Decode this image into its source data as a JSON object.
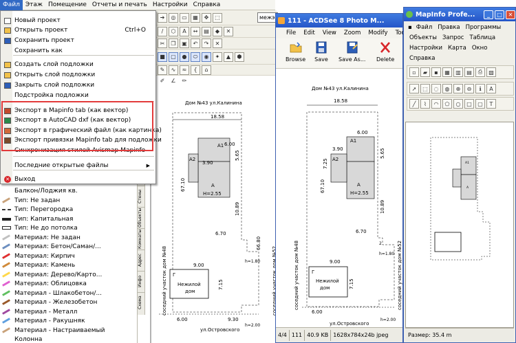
{
  "main_menu": {
    "items": [
      "Файл",
      "Этаж",
      "Помещение",
      "Отчеты и печать",
      "Настройки",
      "Справка"
    ],
    "active": 0
  },
  "toolbar": {
    "combo_value": "межэ"
  },
  "file_menu": {
    "items": [
      {
        "label": "Новый проект",
        "shortcut": "",
        "icon": "new-doc-icon"
      },
      {
        "label": "Открыть проект",
        "shortcut": "Ctrl+O",
        "icon": "open-folder-icon"
      },
      {
        "label": "Сохранить проект",
        "shortcut": "",
        "icon": "save-icon"
      },
      {
        "label": "Сохранить как",
        "shortcut": "",
        "icon": ""
      },
      {
        "label": "Создать слой подложки",
        "shortcut": "",
        "icon": "new-layer-icon"
      },
      {
        "label": "Открыть слой подложки",
        "shortcut": "",
        "icon": "open-layer-icon"
      },
      {
        "label": "Закрыть слой подложки",
        "shortcut": "",
        "icon": "close-layer-icon"
      },
      {
        "label": "Подстройка подложки",
        "shortcut": "",
        "icon": ""
      },
      {
        "label": "Экспорт в Mapinfo tab (как вектор)",
        "shortcut": "",
        "icon": "mapinfo-export-icon"
      },
      {
        "label": "Экспорт в AutoCAD dxf (как вектор)",
        "shortcut": "",
        "icon": "autocad-export-icon"
      },
      {
        "label": "Экспорт в графический файл (как картинка)",
        "shortcut": "",
        "icon": "image-export-icon"
      },
      {
        "label": "Экспорт привязки Mapinfo tab для подложки",
        "shortcut": "",
        "icon": "binding-export-icon"
      },
      {
        "label": "Синхронизация стилей Avismap-Mapinfo",
        "shortcut": "",
        "icon": ""
      },
      {
        "label": "Последние открытые файлы",
        "shortcut": "",
        "icon": ""
      },
      {
        "label": "Выход",
        "shortcut": "",
        "icon": "exit-icon"
      }
    ]
  },
  "layer_panel": {
    "items": [
      {
        "label": "Балкон/Лоджия кв.",
        "swatch": "none"
      },
      {
        "label": "Тип: Не задан",
        "swatch": "pencil"
      },
      {
        "label": "Тип: Перегородка",
        "swatch": "dash"
      },
      {
        "label": "Тип: Капитальная",
        "swatch": "thick"
      },
      {
        "label": "Тип: Не до потолка",
        "swatch": "box"
      },
      {
        "label": "Материал: Не задан",
        "swatch": "pencil"
      },
      {
        "label": "Материал: Бетон/Саман/...",
        "swatch": "pencil"
      },
      {
        "label": "Материал: Кирпич",
        "swatch": "pencil"
      },
      {
        "label": "Материал: Камень",
        "swatch": "pencil"
      },
      {
        "label": "Материал: Дерево/Карто...",
        "swatch": "pencil"
      },
      {
        "label": "Материал: Облицовка",
        "swatch": "pencil"
      },
      {
        "label": "Материал - Шлакобетон/...",
        "swatch": "pencil"
      },
      {
        "label": "Материал - Железобетон",
        "swatch": "pencil"
      },
      {
        "label": "Материал - Металл",
        "swatch": "pencil"
      },
      {
        "label": "Материал - Ракушняк",
        "swatch": "pencil"
      },
      {
        "label": "Материал - Настраиваемый",
        "swatch": "pencil"
      },
      {
        "label": "Колонна",
        "swatch": "none"
      }
    ],
    "side_tabs": [
      "Стены",
      "Объекты",
      "Комнаты",
      "Адрес",
      "Инфо",
      "Схема"
    ]
  },
  "acdsee": {
    "title": "111 - ACDSee 8 Photo M...",
    "menu": [
      "File",
      "Edit",
      "View",
      "Zoom",
      "Modify",
      "Tools"
    ],
    "tools": [
      "Browse",
      "Save",
      "Save As...",
      "Delete"
    ],
    "status": [
      "4/4",
      "111",
      "40.9 KB",
      "1628x784x24b jpeg"
    ]
  },
  "mapinfo": {
    "title": "MapInfo Profe...",
    "menu_row1": [
      "Файл",
      "Правка",
      "Программы"
    ],
    "menu_row2": [
      "Объекты",
      "Запрос",
      "Таблица"
    ],
    "menu_row3": [
      "Настройки",
      "Карта",
      "Окно"
    ],
    "menu_row4": [
      "Справка"
    ],
    "status": "Размер: 35.4 m"
  },
  "plan": {
    "address_top": "Дом №43 ул.Калинина",
    "street_bottom": "ул.Островского",
    "side_left": "соседний участок дом №48",
    "side_right": "соседний участок дом №52",
    "room_a": "А",
    "room_a_area": "H=2.55",
    "room_a1": "А1",
    "room_a2": "А2",
    "room_g": "Г",
    "room_g_text1": "Нежилой",
    "room_g_text2": "дом",
    "d_1858": "18.58",
    "d_600": "6.00",
    "d_390": "3.90",
    "d_565": "5.65",
    "d_6710": "67.10",
    "d_725": "7.25",
    "d_1089": "10.89",
    "d_670": "6.70",
    "d_6680": "66.80",
    "d_h180": "h=1.80",
    "d_2": "2",
    "d_900": "9.00",
    "d_715": "7.15",
    "d_930": "9.30",
    "d_h200": "h=2.00",
    "d_600b": "6.00"
  }
}
